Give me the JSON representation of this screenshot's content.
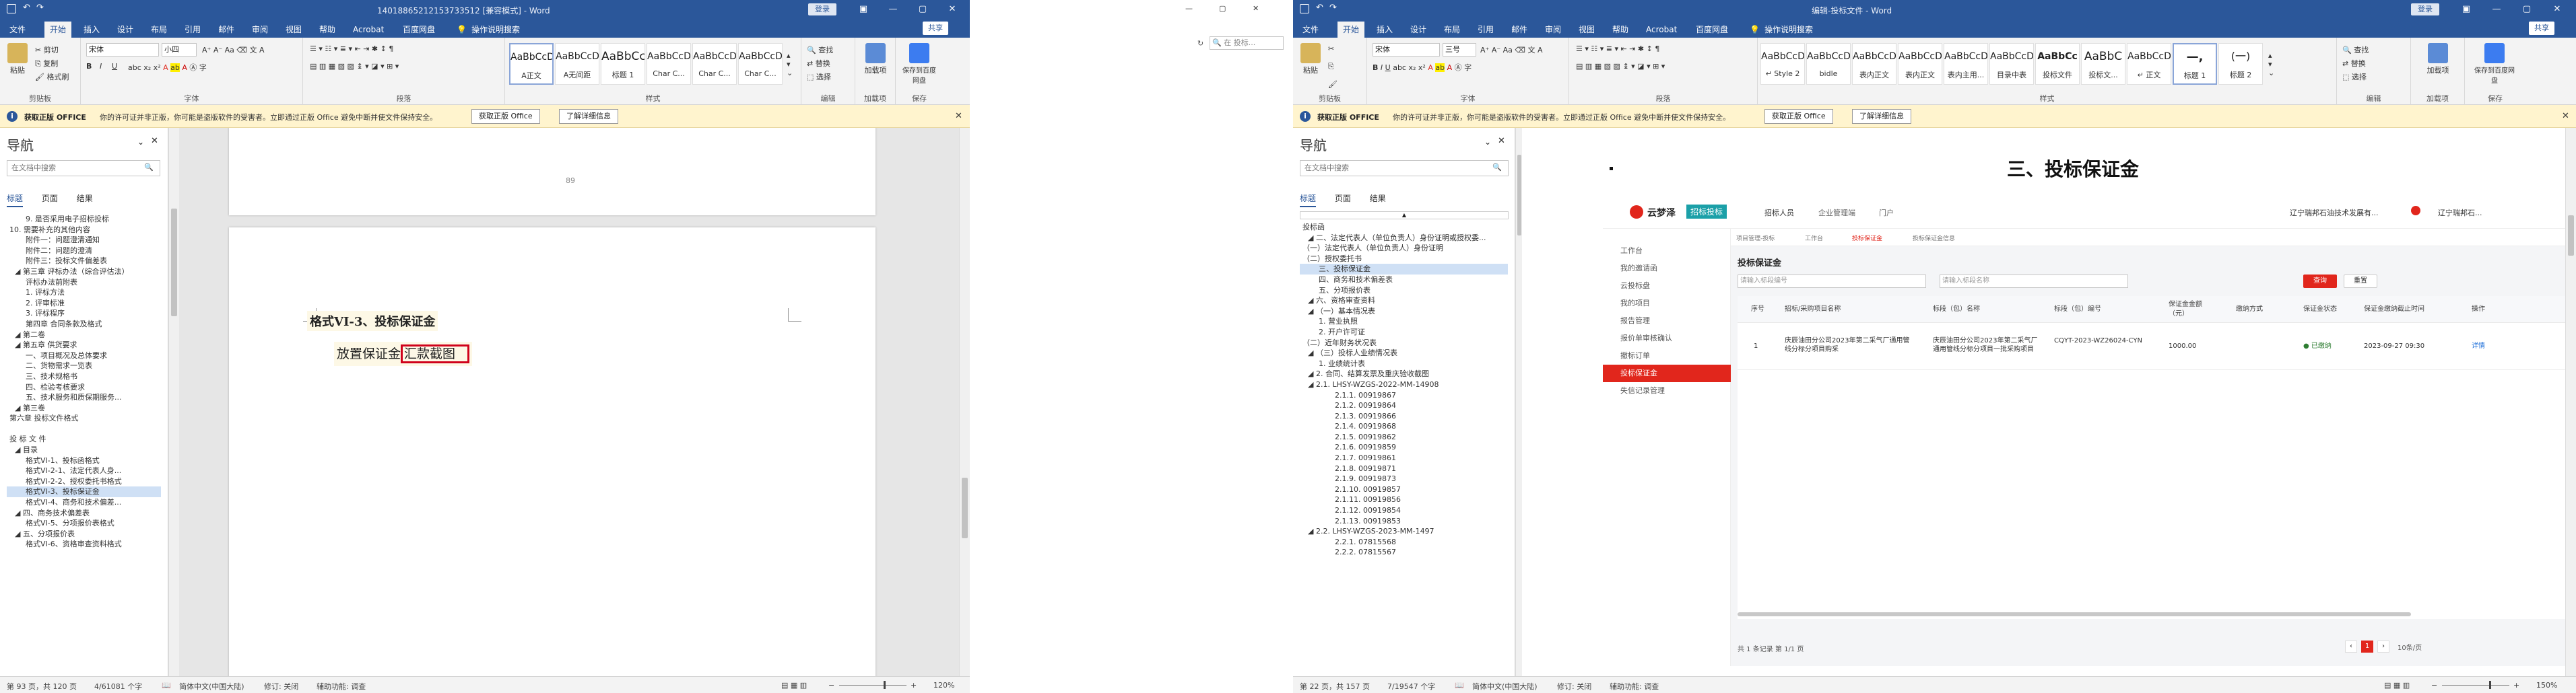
{
  "left_word": {
    "title": "14018865212153733512 [兼容模式] - Word",
    "login": "登录",
    "share": "共享",
    "tabs": [
      "文件",
      "开始",
      "插入",
      "设计",
      "布局",
      "引用",
      "邮件",
      "审阅",
      "视图",
      "帮助",
      "Acrobat",
      "百度网盘"
    ],
    "tell_me": "操作说明搜索",
    "ribbon": {
      "paste": "粘贴",
      "cut": "剪切",
      "copy": "复制",
      "format_painter": "格式刷",
      "clipboard": "剪贴板",
      "font_name": "宋体",
      "font_size": "小四",
      "font_group": "字体",
      "paragraph_group": "段落",
      "styles_group": "样式",
      "styles": [
        {
          "preview": "AaBbCcDd",
          "name": "A正文"
        },
        {
          "preview": "AaBbCcDd",
          "name": "A无间距"
        },
        {
          "preview": "AaBbCc",
          "name": "标题 1"
        },
        {
          "preview": "AaBbCcDc",
          "name": "Char C..."
        },
        {
          "preview": "AaBbCcDd",
          "name": "Char C..."
        },
        {
          "preview": "AaBbCcDd",
          "name": "Char C..."
        }
      ],
      "find": "查找",
      "replace": "替换",
      "select": "选择",
      "editing_group": "编辑",
      "addin": "加载项",
      "addin_group": "加载项",
      "save_baidu": "保存到百度网盘",
      "save_group": "保存"
    },
    "msg": {
      "title": "获取正版 OFFICE",
      "text": "你的许可证并非正版，你可能是盗版软件的受害者。立即通过正版 Office 避免中断并使文件保持安全。",
      "btn1": "获取正版 Office",
      "btn2": "了解详细信息"
    },
    "nav": {
      "title": "导航",
      "search_placeholder": "在文档中搜索",
      "tabs": [
        "标题",
        "页面",
        "结果"
      ],
      "items": [
        "9. 是否采用电子招标投标",
        "10. 需要补充的其他内容",
        "附件一：问题澄清通知",
        "附件二：问题的澄清",
        "附件三：投标文件偏差表",
        "◢ 第三章 评标办法（综合评估法）",
        "评标办法前附表",
        "1. 评标方法",
        "2. 评审标准",
        "3. 评标程序",
        "第四章 合同条款及格式",
        "◢ 第二卷",
        "◢ 第五章 供货要求",
        "一、项目概况及总体要求",
        "二、货物需求一览表",
        "三、技术规格书",
        "四、检验考核要求",
        "五、技术服务和质保期服务...",
        "◢ 第三卷",
        "第六章 投标文件格式",
        "",
        "投 标 文 件",
        "◢ 目录",
        "格式VI-1、投标函格式",
        "格式VI-2-1、法定代表人身...",
        "格式VI-2-2、授权委托书格式",
        "格式VI-3、投标保证金",
        "格式VI-4、商务和技术偏差...",
        "◢ 四、商务技术偏差表",
        "格式VI-5、分项报价表格式",
        "◢ 五、分项报价表",
        "格式VI-6、资格审查资料格式"
      ],
      "selected_index": 26
    },
    "doc": {
      "page_number": "89",
      "heading": "格式VI-3、投标保证金",
      "body_prefix": "放置保证金",
      "body_highlight": "汇款截图"
    },
    "status": {
      "page": "第 93 页，共 120 页",
      "words": "4/61081 个字",
      "lang": "简体中文(中国大陆)",
      "track": "修订: 关闭",
      "access": "辅助功能: 调查",
      "zoom": "120%"
    }
  },
  "middle": {
    "search_placeholder": "在 投标...",
    "controls": [
      "—",
      "▢",
      "✕"
    ]
  },
  "right_word": {
    "title": "编辑-投标文件 - Word",
    "login": "登录",
    "share": "共享",
    "tabs": [
      "文件",
      "开始",
      "插入",
      "设计",
      "布局",
      "引用",
      "邮件",
      "审阅",
      "视图",
      "帮助",
      "Acrobat",
      "百度网盘"
    ],
    "tell_me": "操作说明搜索",
    "ribbon": {
      "paste": "粘贴",
      "clipboard": "剪贴板",
      "font_name": "宋体",
      "font_size": "三号",
      "font_group": "字体",
      "paragraph_group": "段落",
      "styles_group": "样式",
      "styles": [
        {
          "preview": "AaBbCcDc",
          "name": "↵ Style 2"
        },
        {
          "preview": "AaBbCcDi",
          "name": "bidle"
        },
        {
          "preview": "AaBbCcDc",
          "name": "表内正文"
        },
        {
          "preview": "AaBbCcDd",
          "name": "表内正文"
        },
        {
          "preview": "AaBbCcDc",
          "name": "表内主用..."
        },
        {
          "preview": "AaBbCcDc",
          "name": "目录中表"
        },
        {
          "preview": "AaBbCc",
          "name": "投标文件"
        },
        {
          "preview": "AaBbC",
          "name": "投标文..."
        },
        {
          "preview": "AaBbCcDd",
          "name": "↵ 正文"
        },
        {
          "preview": "—,",
          "name": "标题 1"
        },
        {
          "preview": "(一)",
          "name": "标题 2"
        }
      ],
      "find": "查找",
      "replace": "替换",
      "select": "选择",
      "editing_group": "编辑",
      "addin": "加载项",
      "addin_group": "加载项",
      "save_baidu": "保存到百度网盘",
      "save_group": "保存"
    },
    "msg": {
      "title": "获取正版 OFFICE",
      "text": "你的许可证并非正版，你可能是盗版软件的受害者。立即通过正版 Office 避免中断并使文件保持安全。",
      "btn1": "获取正版 Office",
      "btn2": "了解详细信息"
    },
    "nav": {
      "title": "导航",
      "search_placeholder": "在文档中搜索",
      "tabs": [
        "标题",
        "页面",
        "结果"
      ],
      "items": [
        "投标函",
        "◢ 二、法定代表人（单位负责人）身份证明或授权委...",
        "（一）法定代表人（单位负责人）身份证明",
        "（二）授权委托书",
        "三、投标保证金",
        "四、商务和技术偏差表",
        "五、分项报价表",
        "◢ 六、资格审查资料",
        "◢ （一）基本情况表",
        "1. 营业执照",
        "2. 开户许可证",
        "（二）近年财务状况表",
        "◢ （三）投标人业绩情况表",
        "1. 业绩统计表",
        "◢ 2. 合同、结算发票及重庆验收截图",
        "◢ 2.1. LHSY-WZGS-2022-MM-14908",
        "2.1.1. 00919867",
        "2.1.2. 00919864",
        "2.1.3. 00919866",
        "2.1.4. 00919868",
        "2.1.5. 00919862",
        "2.1.6. 00919859",
        "2.1.7. 00919861",
        "2.1.8. 00919871",
        "2.1.9. 00919873",
        "2.1.10. 00919857",
        "2.1.11. 00919856",
        "2.1.12. 00919854",
        "2.1.13. 00919853",
        "◢ 2.2. LHSY-WZGS-2023-MM-1497",
        "2.2.1. 07815568",
        "2.2.2. 07815567"
      ],
      "selected_index": 4
    },
    "doc": {
      "heading": "三、投标保证金",
      "web": {
        "logo": "云梦泽",
        "logo_badge": "招标投标",
        "top_nav": [
          "招标人员",
          "企业管理端",
          "门户"
        ],
        "user": "辽宁瑞邦石油技术发展有...",
        "user2": "辽宁瑞邦石...",
        "breadcrumb_tabs": [
          "项目管理-投标",
          "工作台",
          "投标保证金",
          "投标保证金信息"
        ],
        "sidebar": [
          "工作台",
          "我的邀请函",
          "云投标盘",
          "我的项目",
          "报告管理",
          "报价单审核确认",
          "撤标订单",
          "投标保证金",
          "失信记录管理"
        ],
        "sidebar_selected": 7,
        "page_title": "投标保证金",
        "search1": "请输入标段编号",
        "search2": "请输入标段名称",
        "btn_search": "查询",
        "btn_reset": "重置",
        "columns": [
          "序号",
          "招标/采购项目名称",
          "标段（包）名称",
          "标段（包）编号",
          "保证金金额（元）",
          "缴纳方式",
          "保证金状态",
          "保证金缴纳截止时间",
          "操作"
        ],
        "row": {
          "no": "1",
          "project": "庆辰油田分公司2023年第二采气厂通用管线分标分项目购采",
          "section": "庆辰油田分公司2023年第二采气厂通用管线分标分项目一批采购项目",
          "section_no": "CQYT-2023-WZ26024-CYN",
          "amount": "1000.00",
          "method": "",
          "status": "● 已缴纳",
          "deadline": "2023-09-27 09:30",
          "action": "详情"
        },
        "footer": "共 1 条记录  第 1/1 页",
        "page": "1",
        "per_page": "10条/页"
      }
    },
    "status": {
      "page": "第 22 页，共 157 页",
      "words": "7/19547 个字",
      "lang": "简体中文(中国大陆)",
      "track": "修订: 关闭",
      "access": "辅助功能: 调查",
      "zoom": "150%"
    }
  }
}
